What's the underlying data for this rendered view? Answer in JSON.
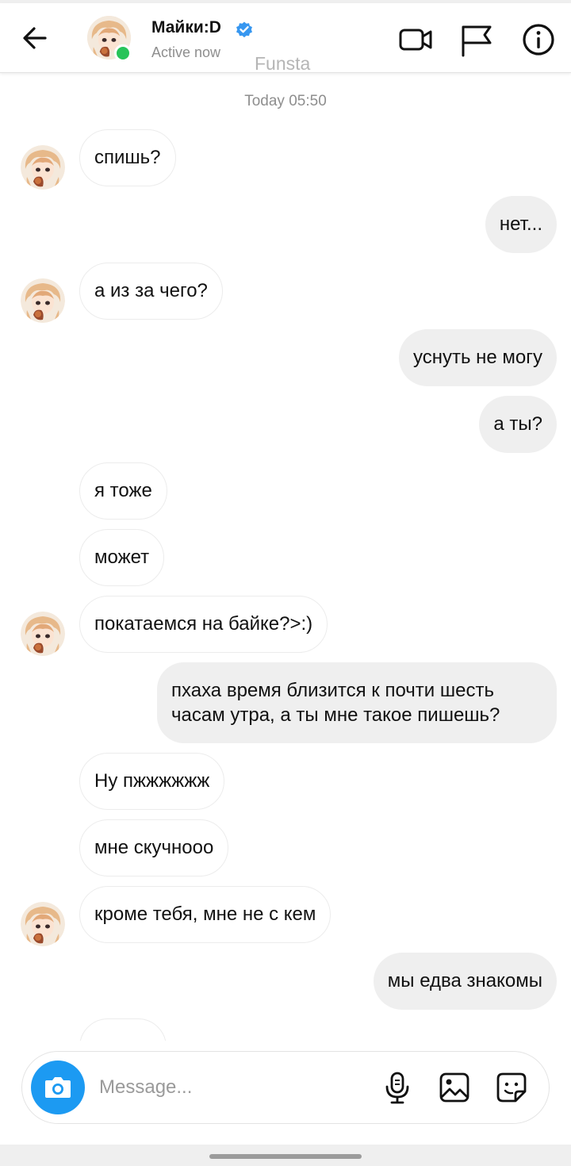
{
  "header": {
    "username": "Майки:D",
    "status": "Active now",
    "watermark": "Funsta"
  },
  "timestamp": "Today 05:50",
  "messages": [
    {
      "dir": "in",
      "text": "спишь?",
      "avatar": true
    },
    {
      "dir": "out",
      "text": "нет..."
    },
    {
      "dir": "in",
      "text": "а из за чего?",
      "avatar": true
    },
    {
      "dir": "out",
      "text": "уснуть не могу"
    },
    {
      "dir": "out",
      "text": "а ты?"
    },
    {
      "dir": "in",
      "text": "я тоже",
      "avatar": false
    },
    {
      "dir": "in",
      "text": "может",
      "avatar": false
    },
    {
      "dir": "in",
      "text": "покатаемся на байке?>:)",
      "avatar": true
    },
    {
      "dir": "out",
      "text": "пхаха время близится к почти шесть часам утра, а ты мне такое пишешь?"
    },
    {
      "dir": "in",
      "text": "Ну пжжжжжж",
      "avatar": false
    },
    {
      "dir": "in",
      "text": "мне скучнооо",
      "avatar": false
    },
    {
      "dir": "in",
      "text": "кроме тебя, мне не с кем",
      "avatar": true
    },
    {
      "dir": "out",
      "text": "мы едва знакомы"
    }
  ],
  "composer": {
    "placeholder": "Message..."
  },
  "colors": {
    "accent_blue": "#1c9af2",
    "online_green": "#28c45a",
    "outgoing_bubble": "#efefef",
    "incoming_border": "#ececec"
  },
  "icons": [
    "back-arrow-icon",
    "verified-badge-icon",
    "video-call-icon",
    "flag-icon",
    "info-icon",
    "camera-icon",
    "microphone-icon",
    "gallery-icon",
    "sticker-icon"
  ]
}
